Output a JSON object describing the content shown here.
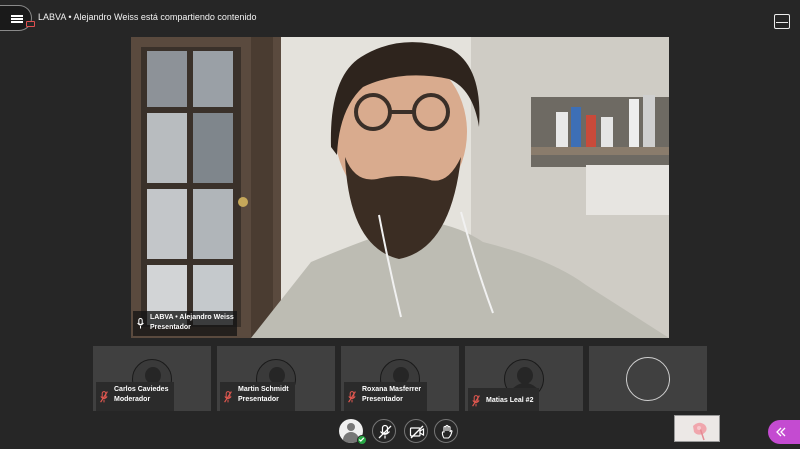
{
  "header": {
    "title": "LABVA • Alejandro Weiss está compartiendo contenido",
    "menu_icon": "hamburger-icon",
    "recording_icon": "recording-indicator-icon",
    "layout_icon": "layout-toggle-icon"
  },
  "presenter": {
    "name": "LABVA • Alejandro Weiss",
    "role": "Presentador",
    "mic_icon": "microphone-icon"
  },
  "participants": [
    {
      "name": "Carlos Caviedes",
      "role": "Moderador",
      "mic": "mic-muted-icon"
    },
    {
      "name": "Martin Schmidt",
      "role": "Presentador",
      "mic": "mic-muted-icon"
    },
    {
      "name": "Roxana Masferrer",
      "role": "Presentador",
      "mic": "mic-muted-icon"
    },
    {
      "name": "Matias Leal #2",
      "role": "",
      "mic": "mic-muted-icon"
    }
  ],
  "controls": {
    "avatar_icon": "user-avatar-icon",
    "status_icon": "check-status-icon",
    "mic_button_icon": "mic-off-icon",
    "camera_button_icon": "camera-off-icon",
    "hand_button_icon": "raise-hand-icon",
    "collapse_icon": "double-chevron-left-icon"
  },
  "colors": {
    "background": "#262626",
    "tile": "#404040",
    "muted_mic": "#e0574f",
    "status_ok": "#28a745",
    "collab_panel": "#c44bd1"
  }
}
